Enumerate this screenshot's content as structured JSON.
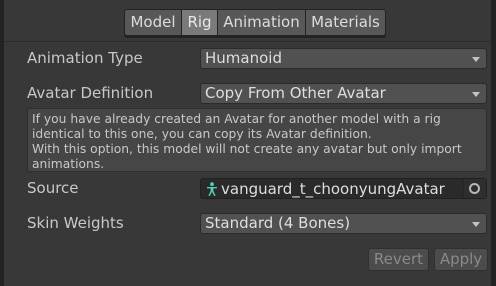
{
  "tabs": [
    {
      "label": "Model",
      "active": false
    },
    {
      "label": "Rig",
      "active": true
    },
    {
      "label": "Animation",
      "active": false
    },
    {
      "label": "Materials",
      "active": false
    }
  ],
  "rig": {
    "animation_type": {
      "label": "Animation Type",
      "value": "Humanoid"
    },
    "avatar_definition": {
      "label": "Avatar Definition",
      "value": "Copy From Other Avatar"
    },
    "help": [
      "If you have already created an Avatar for another model with a rig",
      "identical to this one, you can copy its Avatar definition.",
      "With this option, this model will not create any avatar but only import",
      "animations."
    ],
    "source": {
      "label": "Source",
      "value": "vanguard_t_choonyungAvatar",
      "icon": "avatar-icon"
    },
    "skin_weights": {
      "label": "Skin Weights",
      "value": "Standard (4 Bones)"
    }
  },
  "buttons": {
    "revert": "Revert",
    "apply": "Apply"
  },
  "colors": {
    "panel_bg": "#383838",
    "avatar_icon": "#4fd1b5"
  }
}
